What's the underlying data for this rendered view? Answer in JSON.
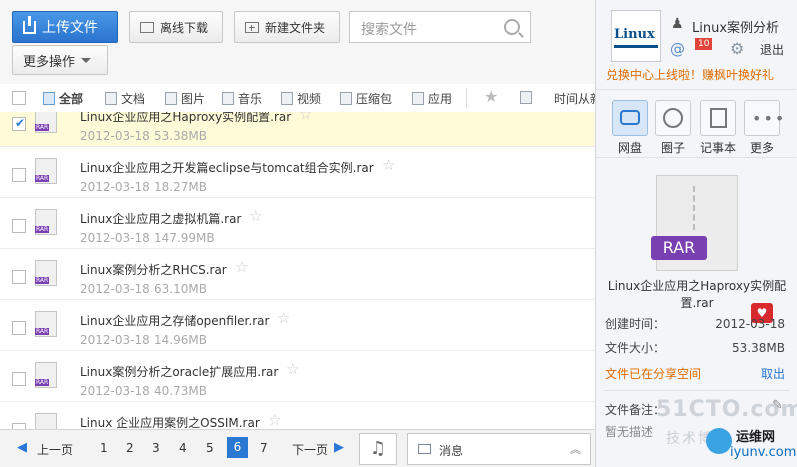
{
  "toolbar": {
    "upload_label": "上传文件",
    "offline_label": "离线下载",
    "newfolder_label": "新建文件夹",
    "search_placeholder": "搜索文件",
    "more_label": "更多操作"
  },
  "filters": {
    "all": "全部",
    "doc": "文档",
    "image": "图片",
    "music": "音乐",
    "video": "视频",
    "archive": "压缩包",
    "app": "应用",
    "sort_label": "时间从新"
  },
  "files": [
    {
      "name": "Linux企业应用之Haproxy实例配置.rar",
      "date": "2012-03-18",
      "size": "53.38MB",
      "selected": true
    },
    {
      "name": "Linux企业应用之开发篇eclipse与tomcat组合实例.rar",
      "date": "2012-03-18",
      "size": "18.27MB",
      "selected": false
    },
    {
      "name": "Linux企业应用之虚拟机篇.rar",
      "date": "2012-03-18",
      "size": "147.99MB",
      "selected": false
    },
    {
      "name": "Linux案例分析之RHCS.rar",
      "date": "2012-03-18",
      "size": "63.10MB",
      "selected": false
    },
    {
      "name": "Linux企业应用之存储openfiler.rar",
      "date": "2012-03-18",
      "size": "14.96MB",
      "selected": false
    },
    {
      "name": "Linux案例分析之oracle扩展应用.rar",
      "date": "2012-03-18",
      "size": "40.73MB",
      "selected": false
    },
    {
      "name": "Linux 企业应用案例之OSSIM.rar",
      "date": "",
      "size": "",
      "selected": false
    }
  ],
  "pager": {
    "prev": "上一页",
    "next": "下一页",
    "pages": [
      "1",
      "2",
      "3",
      "4",
      "5",
      "6",
      "7"
    ],
    "current": "6",
    "msg_label": "消息"
  },
  "right": {
    "book_label": "Linux",
    "username": "Linux案例分析",
    "badge": "10",
    "logout": "退出",
    "promo": "兑换中心上线啦！赚枫叶换好礼",
    "nav": [
      "网盘",
      "圈子",
      "记事本",
      "更多"
    ],
    "rar_badge": "RAR",
    "selected_name": "Linux企业应用之Haproxy实例配置.rar",
    "created_label": "创建时间：",
    "created_value": "2012-03-18",
    "size_label": "文件大小：",
    "size_value": "53.38MB",
    "share_status": "文件已在分享空间",
    "share_cancel": "取出",
    "note_label": "文件备注：",
    "note_value": "暂无描述",
    "watermark_1": "51CTO.com",
    "watermark_2": "技术博客",
    "watermark_3": "运维网",
    "watermark_4": "iyunv.com"
  },
  "colors": {
    "primary": "#2b78d3",
    "promo": "#e06b00",
    "share": "#e06b00",
    "badge": "#e0443a"
  }
}
